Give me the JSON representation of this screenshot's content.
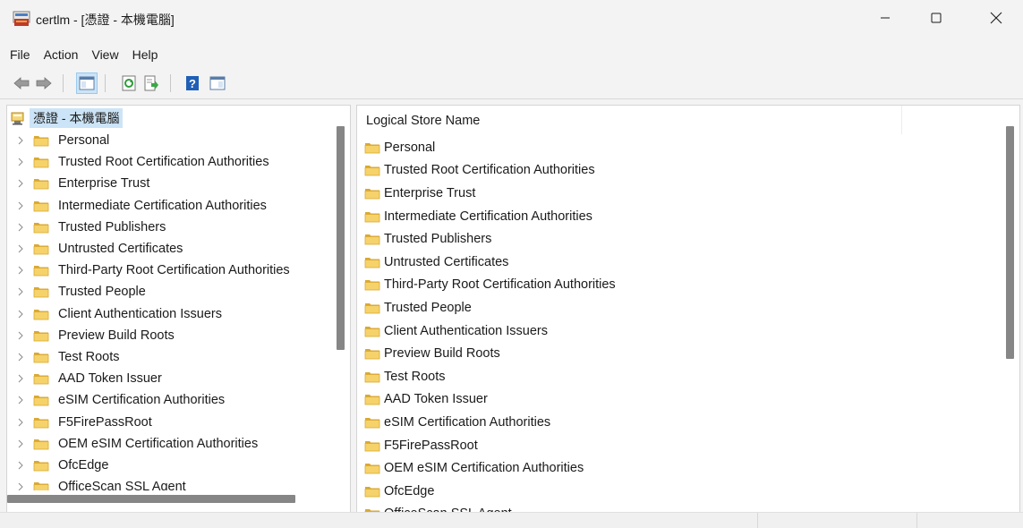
{
  "window": {
    "title": "certlm - [憑證 - 本機電腦]",
    "icon": "certificate-console-icon",
    "controls": [
      "minimize",
      "maximize",
      "close"
    ]
  },
  "menu": {
    "items": [
      "File",
      "Action",
      "View",
      "Help"
    ]
  },
  "toolbar": {
    "buttons": [
      "back-arrow-icon",
      "forward-arrow-icon",
      "show-hide-console-tree-icon",
      "refresh-icon",
      "export-list-icon",
      "help-icon",
      "show-hide-action-pane-icon"
    ]
  },
  "tree": {
    "root_label": "憑證 - 本機電腦",
    "items": [
      "Personal",
      "Trusted Root Certification Authorities",
      "Enterprise Trust",
      "Intermediate Certification Authorities",
      "Trusted Publishers",
      "Untrusted Certificates",
      "Third-Party Root Certification Authorities",
      "Trusted People",
      "Client Authentication Issuers",
      "Preview Build Roots",
      "Test Roots",
      "AAD Token Issuer",
      "eSIM Certification Authorities",
      "F5FirePassRoot",
      "OEM eSIM Certification Authorities",
      "OfcEdge",
      "OfficeScan SSL Agent"
    ]
  },
  "list": {
    "column_header": "Logical Store Name",
    "items": [
      "Personal",
      "Trusted Root Certification Authorities",
      "Enterprise Trust",
      "Intermediate Certification Authorities",
      "Trusted Publishers",
      "Untrusted Certificates",
      "Third-Party Root Certification Authorities",
      "Trusted People",
      "Client Authentication Issuers",
      "Preview Build Roots",
      "Test Roots",
      "AAD Token Issuer",
      "eSIM Certification Authorities",
      "F5FirePassRoot",
      "OEM eSIM Certification Authorities",
      "OfcEdge",
      "OfficeScan SSL Agent"
    ]
  },
  "colors": {
    "folder_fill": "#f6d26b",
    "folder_edge": "#d9a933",
    "selection": "#cce4f7",
    "scroll_thumb": "#868686"
  }
}
